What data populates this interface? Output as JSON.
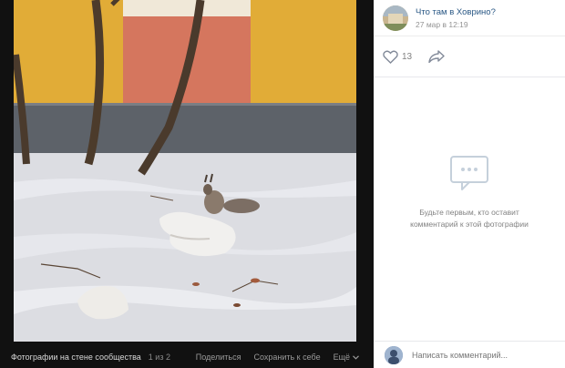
{
  "post": {
    "group_name": "Что там в Ховрино?",
    "time": "27 мар в 12:19",
    "likes": "13"
  },
  "comments": {
    "empty_line1": "Будьте первым, кто оставит",
    "empty_line2": "комментарий к этой фотографии",
    "placeholder": "Написать комментарий..."
  },
  "viewer": {
    "album_title": "Фотографии на стене сообщества",
    "counter": "1 из 2",
    "share": "Поделиться",
    "save": "Сохранить к себе",
    "more": "Ещё"
  },
  "icons": {
    "like": "heart-icon",
    "share": "share-arrow-icon",
    "comments_empty": "comment-bubble-icon",
    "more": "chevron-down-icon"
  }
}
